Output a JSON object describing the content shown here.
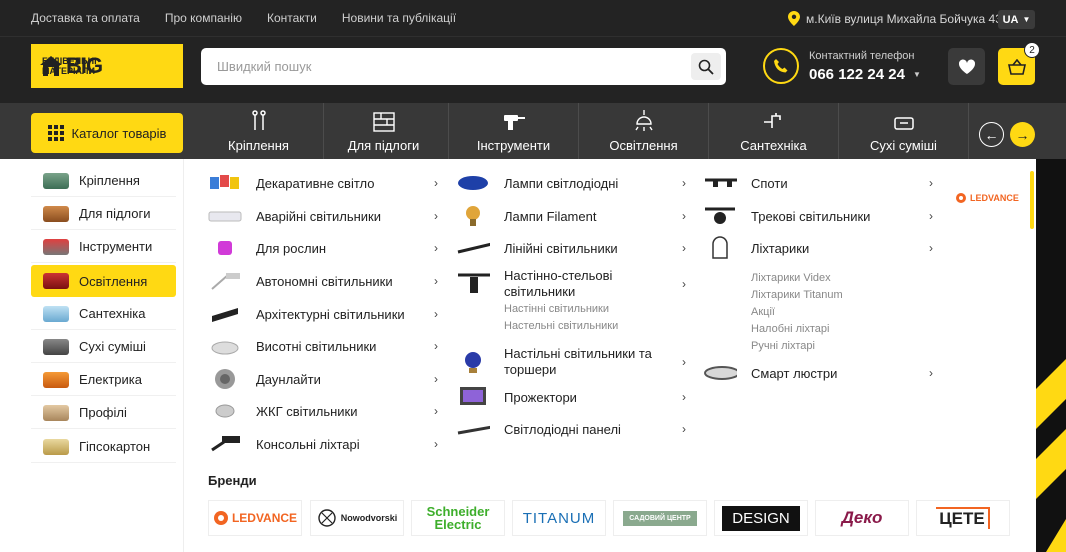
{
  "topbar": {
    "links": [
      "Доставка та оплата",
      "Про компанію",
      "Контакти",
      "Новини та публікації"
    ],
    "address": "м.Київ вулиця Михайла Бойчука 43",
    "lang": "UA"
  },
  "header": {
    "logo_big": "BIG",
    "logo_sub1": "БУДІВЕЛЬНІ",
    "logo_sub2": "МАТЕРІАЛИ",
    "search_placeholder": "Швидкий пошук",
    "phone_label": "Контактний телефон",
    "phone_number": "066 122 24 24",
    "cart_count": "2"
  },
  "nav": {
    "catalog": "Каталог товарів",
    "items": [
      "Кріплення",
      "Для підлоги",
      "Інструменти",
      "Освітлення",
      "Сантехніка",
      "Сухі суміші"
    ]
  },
  "sidebar": {
    "items": [
      "Кріплення",
      "Для підлоги",
      "Інструменти",
      "Освітлення",
      "Сантехніка",
      "Сухі суміші",
      "Електрика",
      "Профілі",
      "Гіпсокартон"
    ],
    "active": "Освітлення"
  },
  "menu": {
    "col1": [
      "Декаративне світло",
      "Аварійні світильники",
      "Для рослин",
      "Автономні світильники",
      "Архітектурні світильники",
      "Висотні світильники",
      "Даунлайти",
      "ЖКГ світильники",
      "Консольні ліхтарі"
    ],
    "col2": [
      "Лампи світлодіодні",
      "Лампи Filament",
      "Лінійні світильники"
    ],
    "col2_wall_1": "Настінно-стельові",
    "col2_wall_2": "світильники",
    "col2_wall_subs": [
      "Настінні світильники",
      "Настельні світильники"
    ],
    "col2_table_1": "Настільні світильники та",
    "col2_table_2": "торшери",
    "col2_rest": [
      "Прожектори",
      "Світлодіодні панелі"
    ],
    "col3": [
      "Споти",
      "Трекові світильники",
      "Ліхтарики"
    ],
    "col3_subs": [
      "Ліхтарики Videx",
      "Ліхтарики Titanum",
      "Акції",
      "Налобні ліхтарі",
      "Ручні ліхтарі"
    ],
    "col3_last": "Смарт люстри",
    "side_brand": "LEDVANCE"
  },
  "brands": {
    "title": "Бренди",
    "items": [
      "LEDVANCE",
      "Nowodvorski",
      "Schneider Electric",
      "TITANUM",
      "САДОВИЙ ЦЕНТР",
      "DESIGN",
      "Деко",
      "ЦЕТЕ"
    ]
  },
  "colors": {
    "accent": "#ffd913",
    "dark": "#232323"
  }
}
